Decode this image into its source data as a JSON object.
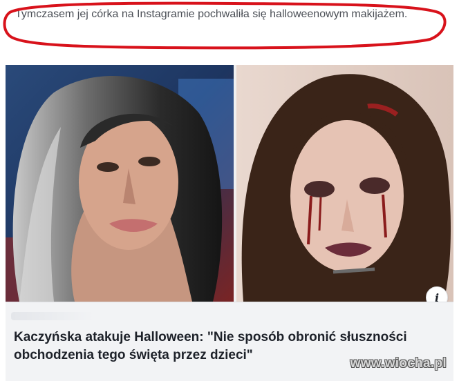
{
  "post": {
    "caption": "Tymczasem jej córka na Instagramie pochwaliła się halloweenowym makijażem."
  },
  "link_preview": {
    "headline": "Kaczyńska atakuje Halloween: \"Nie sposób obronić słuszności obchodzenia tego święta przez dzieci\"",
    "info_icon_glyph": "i"
  },
  "watermark": "www.wiocha.pl",
  "colors": {
    "annotation_red": "#d8121b",
    "link_box_bg": "#f2f3f5",
    "headline_text": "#1d2129",
    "caption_text": "#4b4f56"
  }
}
